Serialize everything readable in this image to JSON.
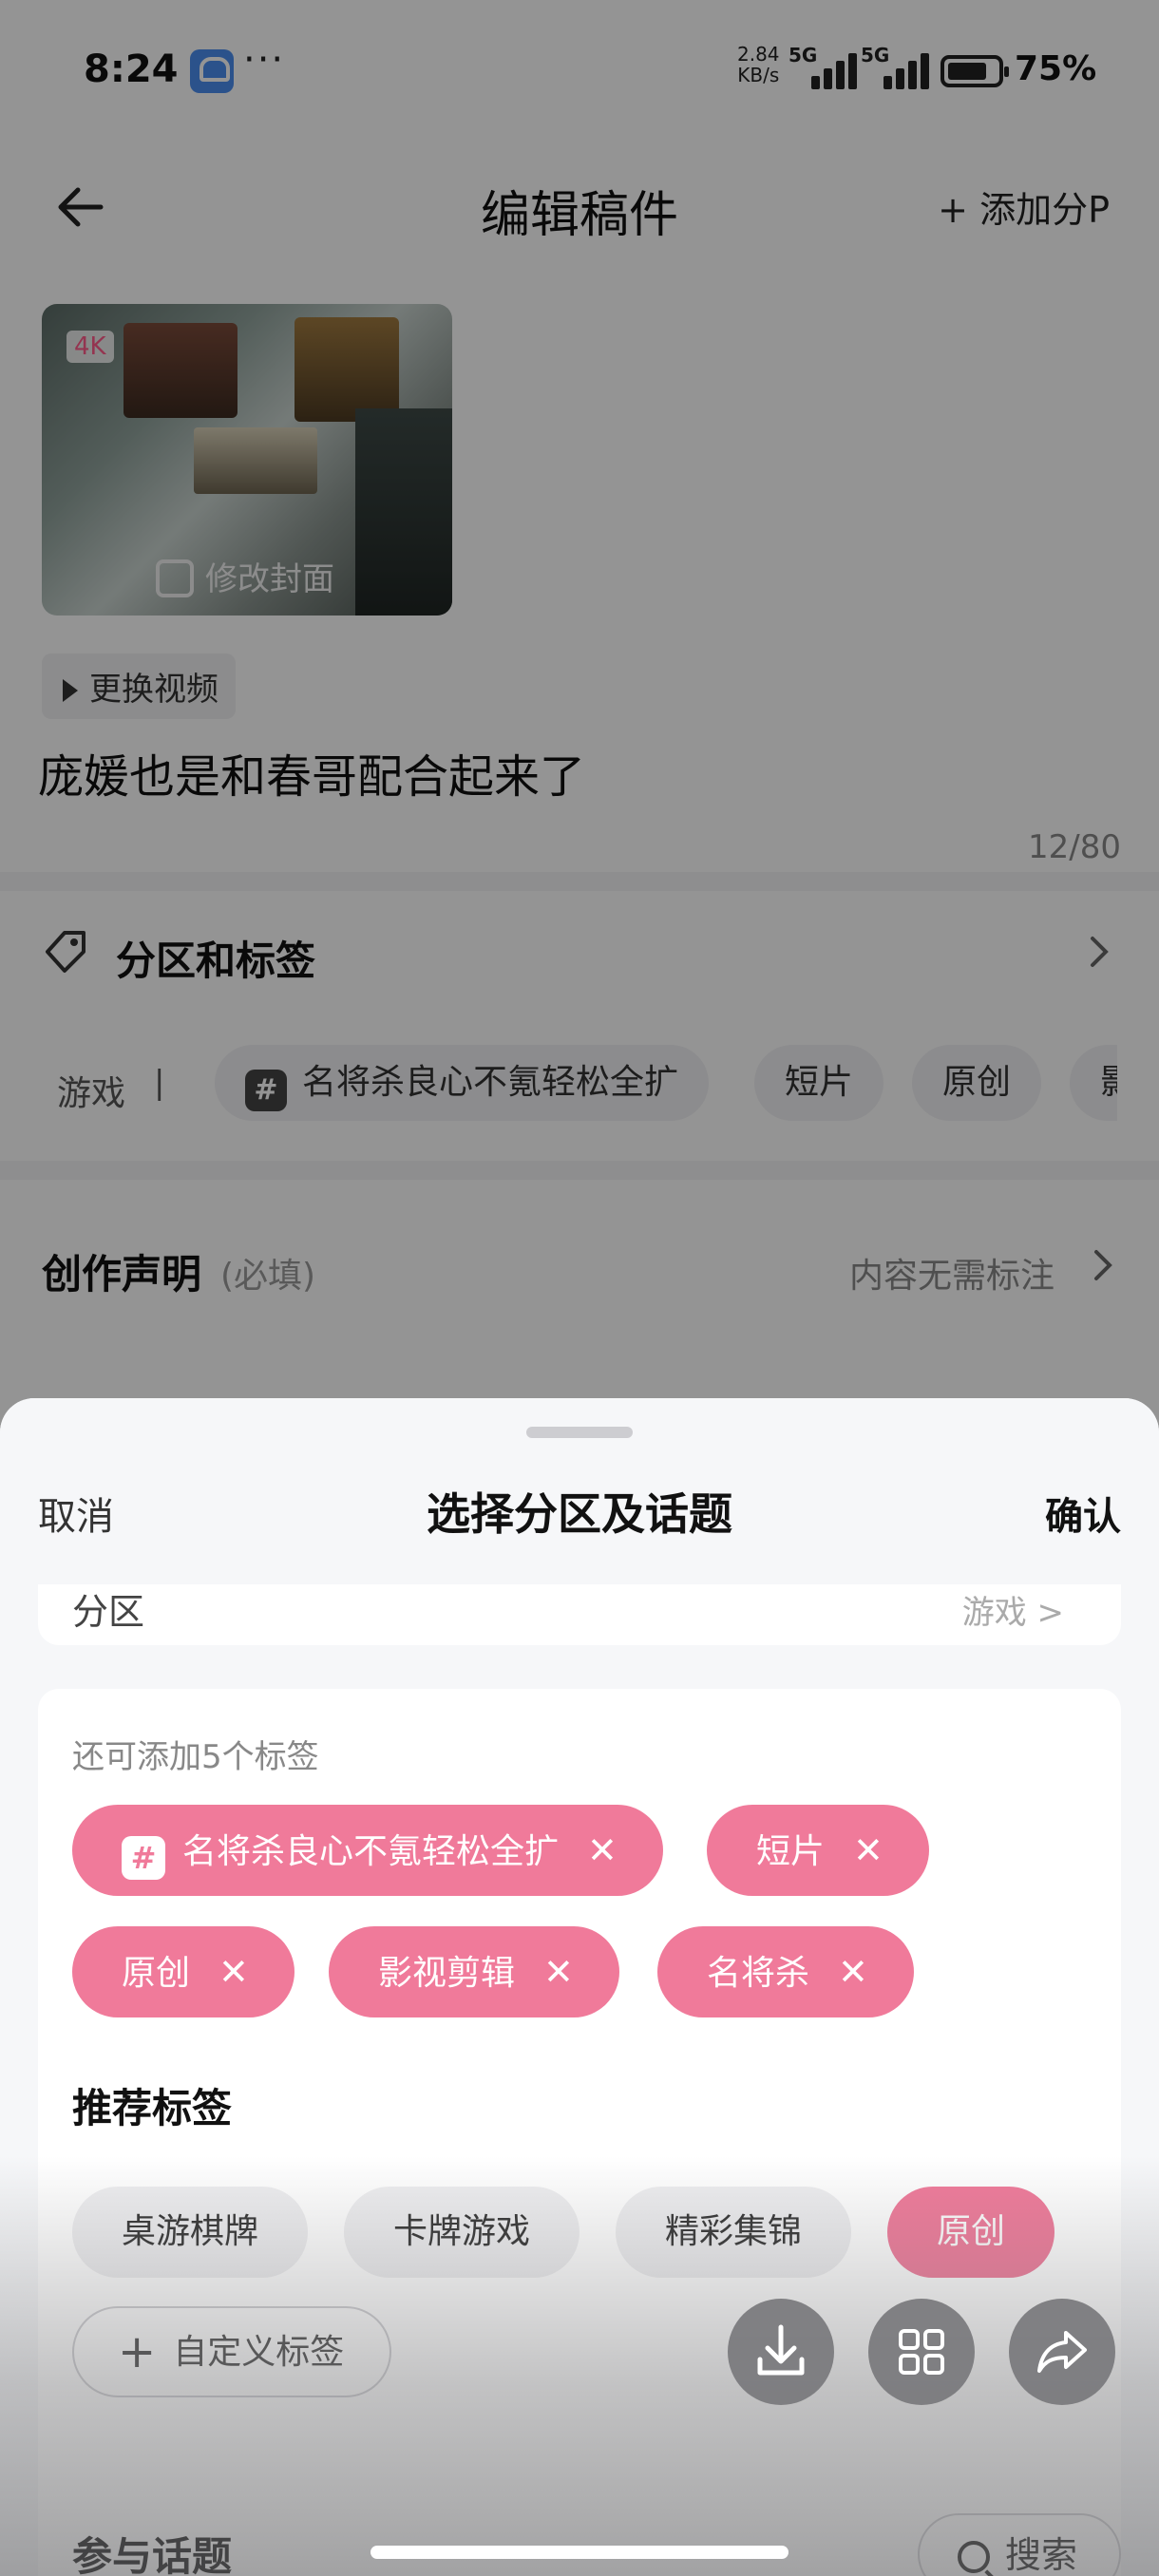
{
  "status_bar": {
    "time": "8:24",
    "more": "···",
    "net_speed_value": "2.84",
    "net_speed_unit": "KB/s",
    "sim1": "5G",
    "sim2": "5G",
    "battery": "75%"
  },
  "nav": {
    "title": "编辑稿件",
    "add_part": "+ 添加分P"
  },
  "cover": {
    "badge": "4K",
    "edit_label": "修改封面"
  },
  "video": {
    "replace_label": "更换视频",
    "title": "庞媛也是和春哥配合起来了",
    "title_count": "12/80"
  },
  "category_section": {
    "label": "分区和标签",
    "category": "游戏",
    "separator": "|",
    "chips": [
      "名将杀良心不氪轻松全扩",
      "短片",
      "原创",
      "影"
    ]
  },
  "declaration": {
    "title": "创作声明",
    "required": "(必填)",
    "value": "内容无需标注"
  },
  "sheet": {
    "cancel": "取消",
    "title": "选择分区及话题",
    "confirm": "确认",
    "area_label": "分区",
    "area_value": "游戏 >",
    "hint": "还可添加5个标签",
    "selected_tags": [
      "名将杀良心不氪轻松全扩",
      "短片",
      "原创",
      "影视剪辑",
      "名将杀"
    ],
    "close_glyph": "✕",
    "recommend_title": "推荐标签",
    "recommended_tags": [
      {
        "label": "桌游棋牌",
        "selected": false
      },
      {
        "label": "卡牌游戏",
        "selected": false
      },
      {
        "label": "精彩集锦",
        "selected": false
      },
      {
        "label": "原创",
        "selected": true
      }
    ],
    "custom_plus": "+",
    "custom_label": "自定义标签",
    "topic_title": "参与话题",
    "search_label": "搜索"
  },
  "floating_actions": [
    "download-icon",
    "grid-icon",
    "share-icon"
  ],
  "colors": {
    "accent_pink": "#f07a9a",
    "sheet_bg": "#f6f7f9"
  }
}
